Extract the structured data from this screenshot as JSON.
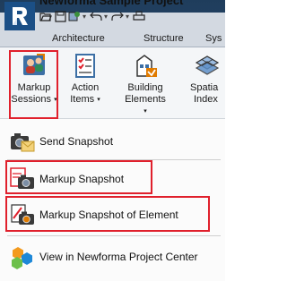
{
  "titlebar": {
    "partial_text": "Newforma Sample Project"
  },
  "tabs": [
    "Architecture",
    "Structure",
    "Sys"
  ],
  "ribbon": {
    "buttons": [
      {
        "line1": "Markup",
        "line2": "Sessions",
        "caret": "▾"
      },
      {
        "line1": "Action",
        "line2": "Items",
        "caret": "▾"
      },
      {
        "line1": "Building",
        "line2": "Elements",
        "caret": "▾"
      },
      {
        "line1": "Spatia",
        "line2": "Index",
        "caret": ""
      }
    ]
  },
  "menu": {
    "items": [
      {
        "label": "Send Snapshot"
      },
      {
        "label": "Markup Snapshot"
      },
      {
        "label": "Markup Snapshot of Element"
      },
      {
        "label": "View in Newforma Project Center"
      }
    ]
  },
  "colors": {
    "highlight": "#e0202c",
    "titlebar": "#213f5f",
    "ribbon_tabs": "#d3d9e1",
    "app_button": "#1b4f86"
  }
}
